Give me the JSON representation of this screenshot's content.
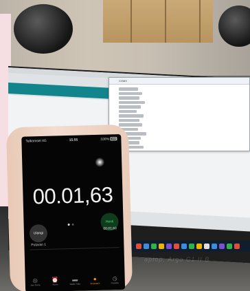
{
  "scene": {
    "colors": {
      "wall": "#cfc5b6",
      "desk": "#3a3a39",
      "phone_body": "#f2ddd0",
      "ide_accent": "#12848b",
      "taskbar": "#0f1d2e"
    }
  },
  "laptop": {
    "serial_monitor": {
      "title": "COM3",
      "line_count": 14
    },
    "taskbar_icons": [
      "#e04e39",
      "#3c8de0",
      "#2fb24a",
      "#f0b400",
      "#7a4fd0",
      "#e04e39",
      "#3c8de0",
      "#2fb24a",
      "#f0b400",
      "#e0e0e0",
      "#3c8de0",
      "#7a4fd0",
      "#2fb24a",
      "#e04e39"
    ],
    "reflection_text": "aptop, Argo C1 II B"
  },
  "phone": {
    "status_bar": {
      "carrier": "Telkomsel 4G",
      "time": "15.55",
      "battery": "100%"
    },
    "stopwatch": {
      "display": "00.01,63",
      "lap_button": "Ulangi",
      "stop_button": "Henti",
      "lap_time_right": "00.01,63",
      "lap_name": "Putaran 1",
      "page": 1,
      "page_count": 2
    },
    "tabs": [
      {
        "label": "Jam Dunia",
        "icon": "globe-icon",
        "glyph": "◎",
        "active": false
      },
      {
        "label": "Alarm",
        "icon": "alarm-icon",
        "glyph": "⏰",
        "active": false
      },
      {
        "label": "Waktu Tidur",
        "icon": "bed-icon",
        "glyph": "▬",
        "active": false
      },
      {
        "label": "Stopwatch",
        "icon": "stopwatch-icon",
        "glyph": "●",
        "active": true
      },
      {
        "label": "Pewaktu",
        "icon": "timer-icon",
        "glyph": "◷",
        "active": false
      }
    ]
  }
}
